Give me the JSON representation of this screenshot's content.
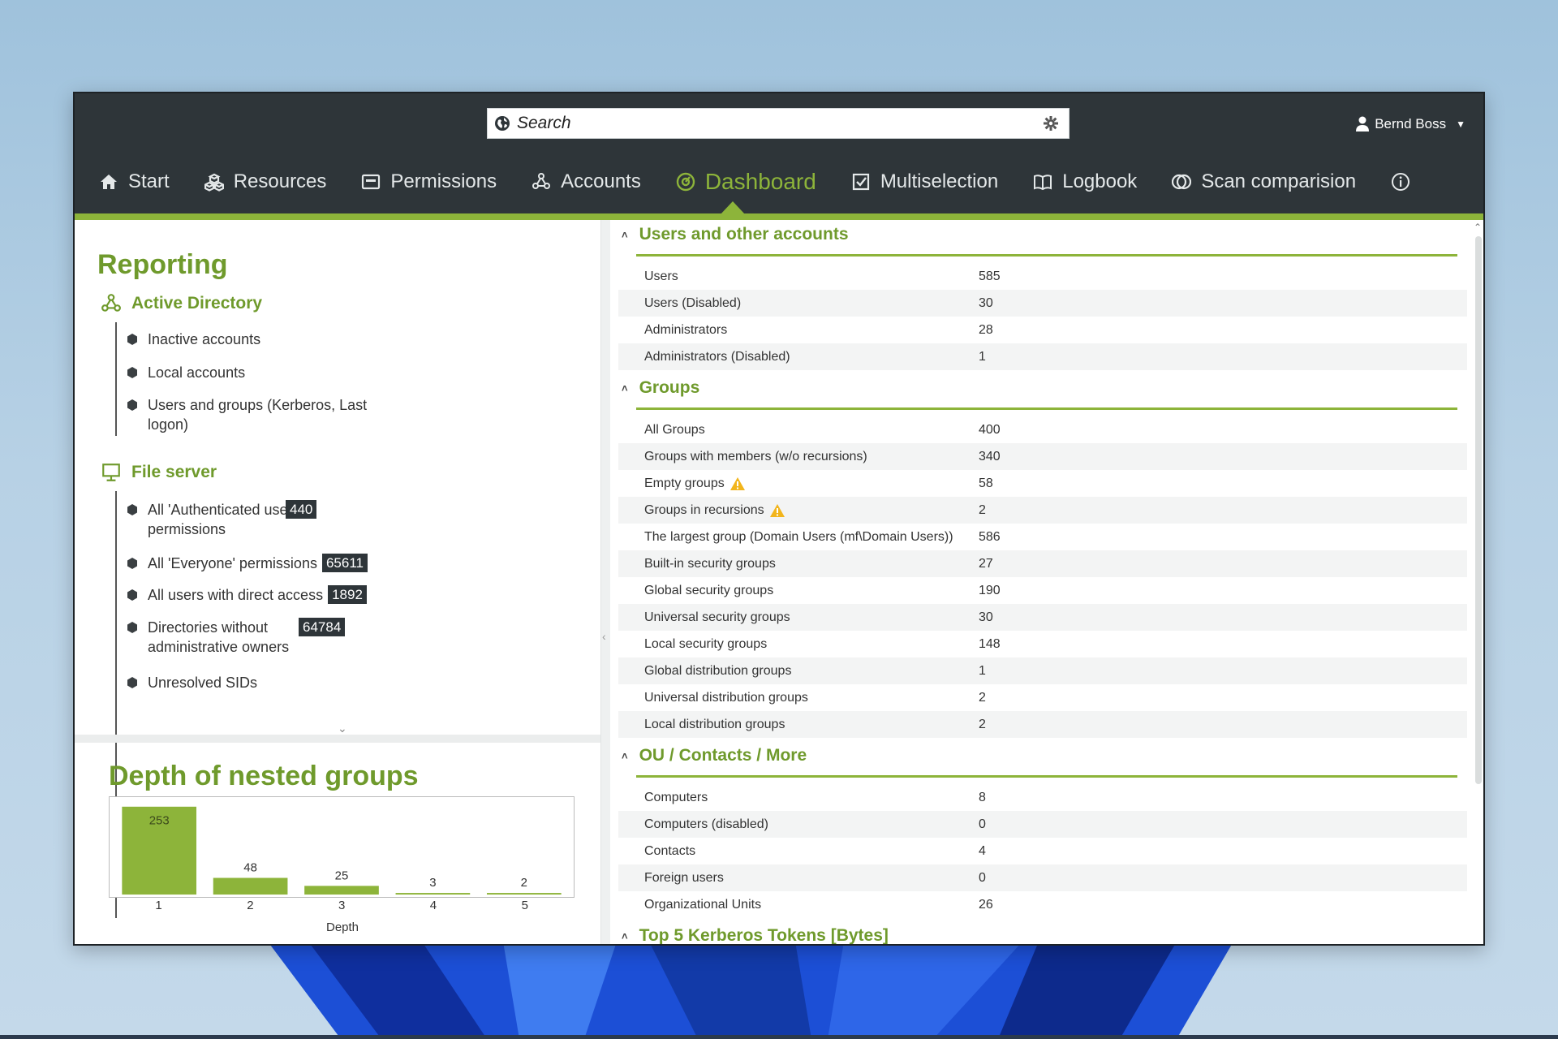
{
  "search": {
    "placeholder": "Search",
    "globe_icon": "globe-icon",
    "settings_icon": "gear-icon"
  },
  "user": {
    "name": "Bernd Boss",
    "icon": "user-icon"
  },
  "nav": {
    "items": [
      {
        "label": "Start",
        "icon": "home-icon"
      },
      {
        "label": "Resources",
        "icon": "resources-icon"
      },
      {
        "label": "Permissions",
        "icon": "permissions-icon"
      },
      {
        "label": "Accounts",
        "icon": "accounts-icon"
      },
      {
        "label": "Dashboard",
        "icon": "dashboard-icon",
        "active": true
      },
      {
        "label": "Multiselection",
        "icon": "checkbox-icon"
      },
      {
        "label": "Logbook",
        "icon": "book-icon"
      },
      {
        "label": "Scan comparision",
        "icon": "compare-icon"
      }
    ],
    "info_icon": "info-icon",
    "accent_color": "#8db43a"
  },
  "reporting": {
    "title": "Reporting",
    "active_directory": {
      "title": "Active Directory",
      "items": [
        {
          "label": "Inactive accounts"
        },
        {
          "label": "Local accounts"
        },
        {
          "label": "Users and groups (Kerberos, Last logon)"
        }
      ]
    },
    "file_server": {
      "title": "File server",
      "items": [
        {
          "label": "All 'Authenticated users' permissions",
          "badge": "440"
        },
        {
          "label": "All 'Everyone' permissions",
          "badge": "65611"
        },
        {
          "label": "All users with direct access",
          "badge": "1892"
        },
        {
          "label": "Directories without administrative owners",
          "badge": "64784"
        },
        {
          "label": "Unresolved SIDs"
        }
      ]
    }
  },
  "depth": {
    "title": "Depth of nested groups",
    "chart_data": {
      "type": "bar",
      "categories": [
        "1",
        "2",
        "3",
        "4",
        "5"
      ],
      "values": [
        253,
        48,
        25,
        3,
        2
      ],
      "xlabel": "Depth",
      "ylabel": "",
      "ylim": [
        0,
        253
      ],
      "color": "#8db43a"
    }
  },
  "sections": [
    {
      "title": "Users and other accounts",
      "rows": [
        {
          "label": "Users",
          "value": "585"
        },
        {
          "label": "Users (Disabled)",
          "value": "30"
        },
        {
          "label": "Administrators",
          "value": "28"
        },
        {
          "label": "Administrators (Disabled)",
          "value": "1"
        }
      ]
    },
    {
      "title": "Groups",
      "rows": [
        {
          "label": "All Groups",
          "value": "400"
        },
        {
          "label": "Groups with members (w/o recursions)",
          "value": "340"
        },
        {
          "label": "Empty groups",
          "value": "58",
          "warning": true
        },
        {
          "label": "Groups in recursions",
          "value": "2",
          "warning": true
        },
        {
          "label": "The largest group (Domain Users (mf\\Domain Users))",
          "value": "586"
        },
        {
          "label": "Built-in security groups",
          "value": "27"
        },
        {
          "label": "Global security groups",
          "value": "190"
        },
        {
          "label": "Universal security groups",
          "value": "30"
        },
        {
          "label": "Local security groups",
          "value": "148"
        },
        {
          "label": "Global distribution groups",
          "value": "1"
        },
        {
          "label": "Universal distribution groups",
          "value": "2"
        },
        {
          "label": "Local distribution groups",
          "value": "2"
        }
      ]
    },
    {
      "title": "OU / Contacts / More",
      "rows": [
        {
          "label": "Computers",
          "value": "8"
        },
        {
          "label": "Computers (disabled)",
          "value": "0"
        },
        {
          "label": "Contacts",
          "value": "4"
        },
        {
          "label": "Foreign users",
          "value": "0"
        },
        {
          "label": "Organizational Units",
          "value": "26"
        }
      ]
    },
    {
      "title": "Top 5 Kerberos Tokens [Bytes]",
      "rows": []
    }
  ]
}
